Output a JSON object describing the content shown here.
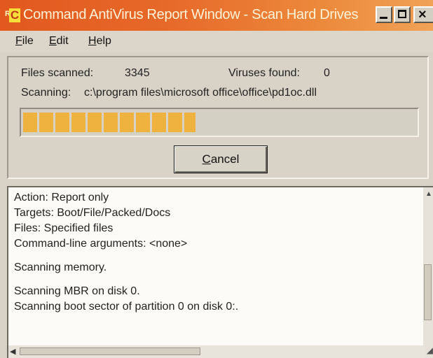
{
  "window": {
    "title": "Command AntiVirus Report Window - Scan Hard Drives",
    "icon_letters": {
      "small": "R",
      "large": "C"
    },
    "icon": "command-antivirus-icon",
    "controls": {
      "minimize": "minimize-icon",
      "maximize": "maximize-icon",
      "close": "close-icon"
    },
    "accent_color": "#e2581e"
  },
  "menu": {
    "items": [
      {
        "mnemonic": "F",
        "rest": "ile"
      },
      {
        "mnemonic": "E",
        "rest": "dit"
      },
      {
        "mnemonic": "H",
        "rest": "elp"
      }
    ]
  },
  "status": {
    "files_scanned_label": "Files scanned:",
    "files_scanned_value": "3345",
    "viruses_found_label": "Viruses found:",
    "viruses_found_value": "0",
    "scanning_label": "Scanning:",
    "current_path": "c:\\program files\\microsoft office\\office\\pd1oc.dll",
    "progress_percent": 44,
    "progress_color": "#f0b23e"
  },
  "cancel_button": {
    "mnemonic": "C",
    "rest": "ancel"
  },
  "log": {
    "lines": [
      "Action: Report only",
      "Targets: Boot/File/Packed/Docs",
      "Files: Specified files",
      "Command-line arguments: <none>",
      "",
      "Scanning memory.",
      "",
      "Scanning MBR on disk 0.",
      "Scanning boot sector of partition 0 on disk 0:."
    ]
  }
}
